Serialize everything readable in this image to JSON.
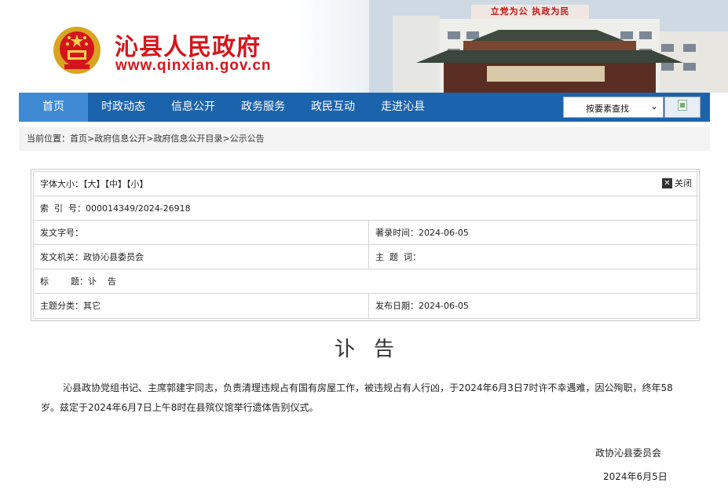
{
  "header": {
    "site_name": "沁县人民政府",
    "site_url": "www.qinxian.gov.cn",
    "slogan": "立党为公 执政为民",
    "gate_plaque": "府大民人县",
    "emblem_icon": "national-emblem-icon"
  },
  "nav": {
    "items": [
      {
        "label": "首页",
        "active": true
      },
      {
        "label": "时政动态"
      },
      {
        "label": "信息公开"
      },
      {
        "label": "政务服务"
      },
      {
        "label": "政民互动"
      },
      {
        "label": "走进沁县"
      }
    ],
    "search_select": "按要素查找",
    "colors": {
      "bar": "#1c63ae",
      "active": "#3e8ad4"
    }
  },
  "breadcrumb": {
    "prefix": "当前位置：",
    "items": [
      "首页",
      "政府信息公开",
      "政府信息公开目录",
      "公示公告"
    ],
    "sep": ">"
  },
  "info": {
    "font_size_label": "字体大小：",
    "font_sizes": [
      "【大】",
      "【中】",
      "【小】"
    ],
    "close_label": "关闭",
    "index_label": "索  引  号：",
    "index_value": "000014349/2024-26918",
    "doc_no_label": "发文字号：",
    "doc_no_value": "",
    "record_time_label": "著录时间：",
    "record_time_value": "2024-06-05",
    "issuer_label": "发文机关：",
    "issuer_value": "政协沁县委员会",
    "subject_label": "主  题  词：",
    "subject_value": "",
    "title_label": "标        题：",
    "title_value": "讣    告",
    "category_label": "主题分类：",
    "category_value": "其它",
    "publish_date_label": "发布日期：",
    "publish_date_value": "2024-06-05"
  },
  "doc": {
    "title": "讣告",
    "body": "沁县政协党组书记、主席郭建宇同志，负责清理违规占有国有房屋工作，被违规占有人行凶，于2024年6月3日7时许不幸遇难，因公殉职，终年58岁。兹定于2024年6月7日上午8时在县殡仪馆举行遗体告别仪式。",
    "sign_org": "政协沁县委员会",
    "sign_date": "2024年6月5日"
  },
  "colors": {
    "brand_red": "#d4161c"
  }
}
